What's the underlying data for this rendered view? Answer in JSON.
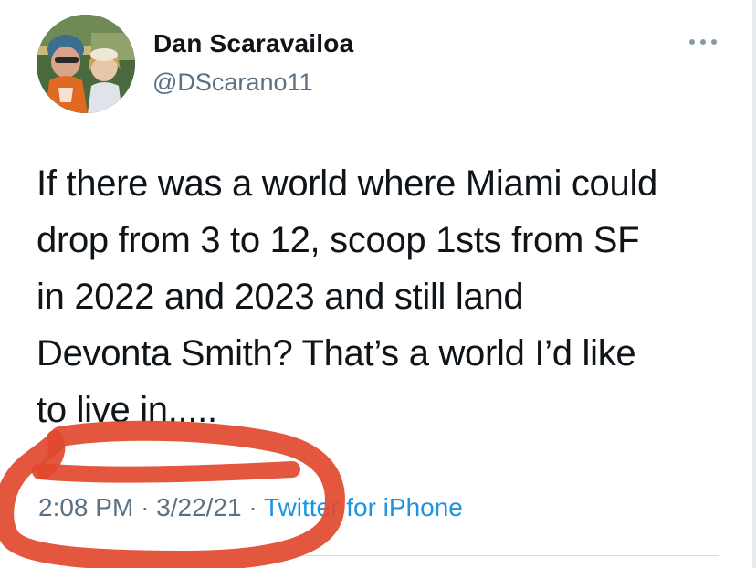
{
  "tweet": {
    "display_name": "Dan Scaravailoa",
    "handle": "@DScarano11",
    "text": "If there was a world where Miami could\ndrop from 3 to 12, scoop 1sts from SF\nin 2022 and 2023 and still land\nDevonta Smith? That’s a world I’d like\nto live in.....",
    "time": "2:08 PM",
    "date": "3/22/21",
    "separator": "·",
    "source": "Twitter for iPhone"
  },
  "icons": {
    "more": "more-horizontal-icon",
    "avatar": "profile-photo"
  },
  "colors": {
    "name": "#0f1419",
    "secondary_text": "#5b7083",
    "link": "#1b95e0",
    "annotation": "#e2492f"
  }
}
